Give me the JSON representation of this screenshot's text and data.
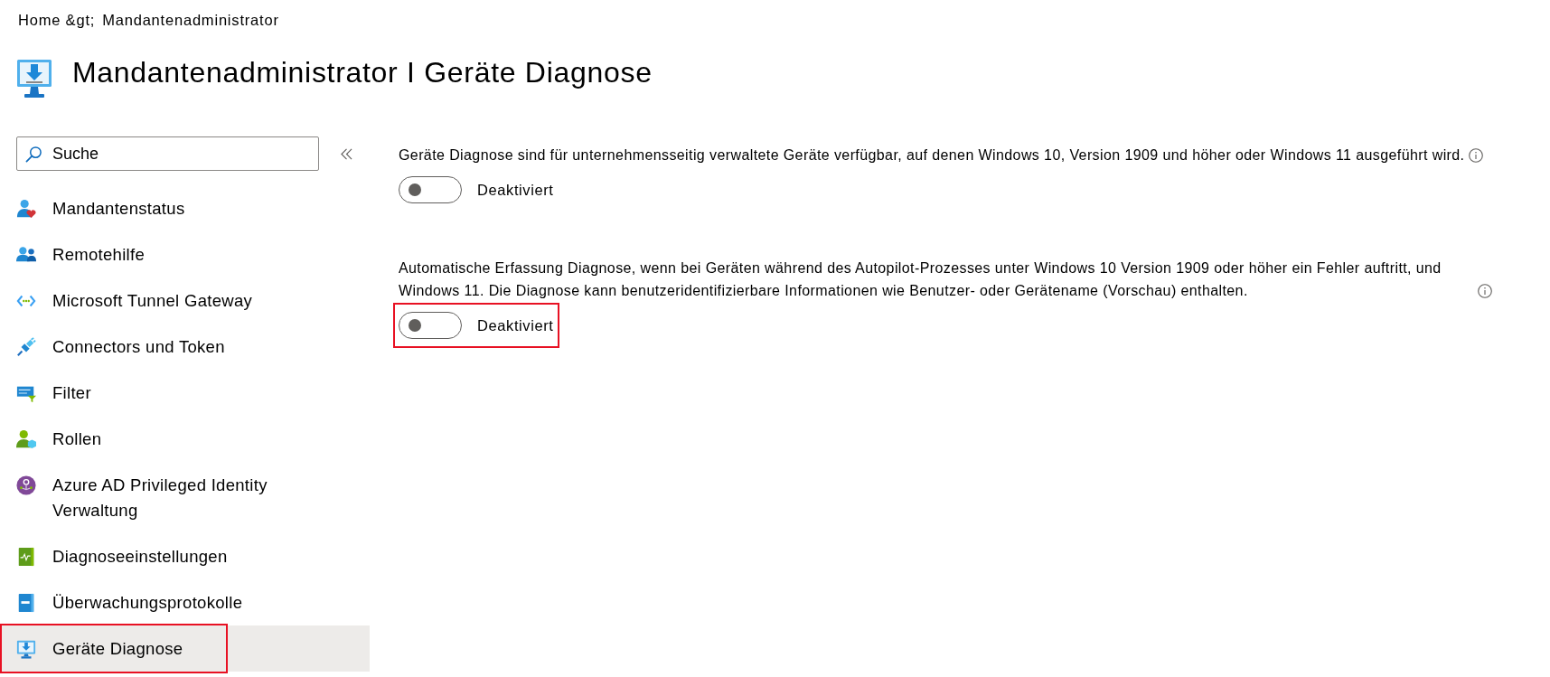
{
  "breadcrumb": [
    {
      "label": "Home &gt;"
    },
    {
      "label": "Mandantenadministrator"
    }
  ],
  "header": {
    "title": "Mandantenadministrator I Geräte Diagnose"
  },
  "search": {
    "placeholder": "Suche"
  },
  "sidebar": {
    "items": [
      {
        "label": "Mandantenstatus",
        "selected": false,
        "highlighted": false
      },
      {
        "label": "Remotehilfe",
        "selected": false,
        "highlighted": false
      },
      {
        "label": "Microsoft Tunnel Gateway",
        "selected": false,
        "highlighted": false
      },
      {
        "label": "Connectors und Token",
        "selected": false,
        "highlighted": false
      },
      {
        "label": "Filter",
        "selected": false,
        "highlighted": false
      },
      {
        "label": "Rollen",
        "selected": false,
        "highlighted": false
      },
      {
        "label": "Azure AD Privileged Identity\nVerwaltung",
        "selected": false,
        "highlighted": false
      },
      {
        "label": "Diagnoseeinstellungen",
        "selected": false,
        "highlighted": false
      },
      {
        "label": "Überwachungsprotokolle",
        "selected": false,
        "highlighted": false
      },
      {
        "label": "Geräte Diagnose",
        "selected": true,
        "highlighted": true
      }
    ]
  },
  "settings": [
    {
      "description": "Geräte Diagnose sind für unternehmensseitig verwaltete Geräte verfügbar, auf denen Windows 10, Version 1909 und höher oder Windows 11 ausgeführt wird.",
      "info_icon": true,
      "toggle": {
        "on": false,
        "label": "Deaktiviert",
        "highlighted": false
      }
    },
    {
      "description": "Automatische Erfassung Diagnose, wenn bei Geräten während des Autopilot-Prozesses unter Windows 10 Version 1909 oder höher ein Fehler auftritt, und Windows 11. Die Diagnose kann benutzeridentifizierbare Informationen wie Benutzer- oder Gerätename (Vorschau) enthalten.",
      "info_icon": true,
      "toggle": {
        "on": false,
        "label": "Deaktiviert",
        "highlighted": true
      }
    }
  ]
}
